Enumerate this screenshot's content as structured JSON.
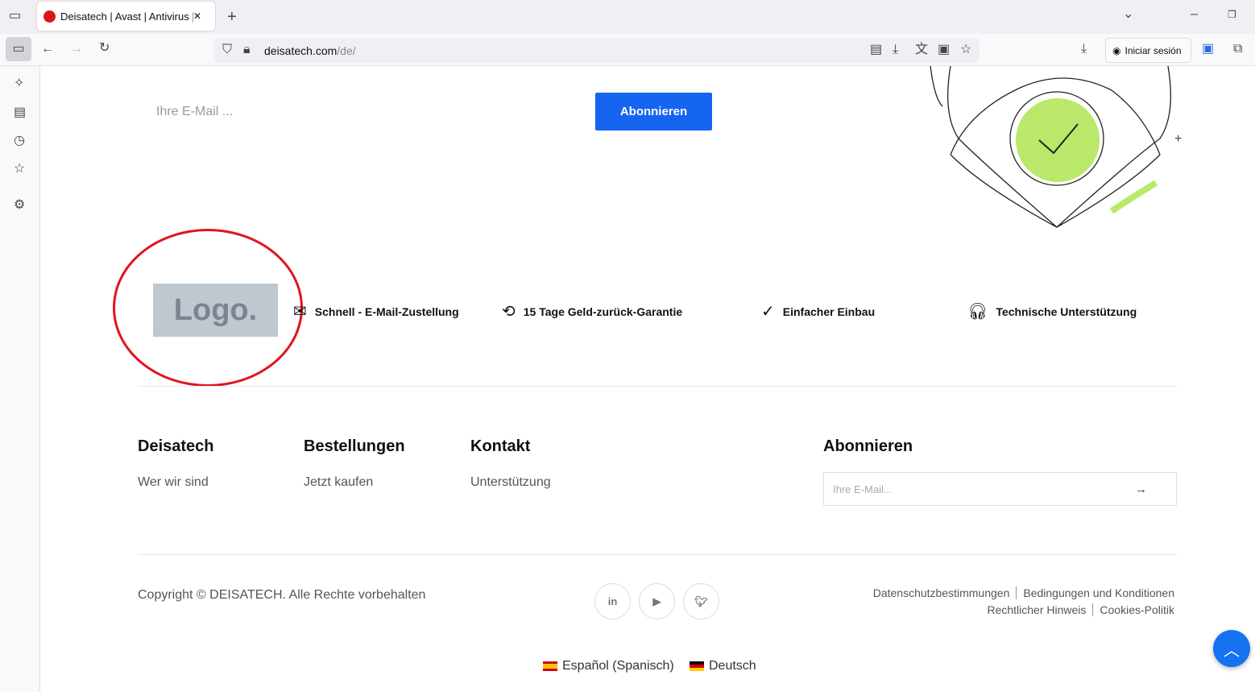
{
  "browser": {
    "tab_title": "Deisatech | Avast | Antivirus | Pr",
    "url_host": "deisatech.com",
    "url_path": "/de/",
    "signin": "Iniciar sesión",
    "new_tab": "+",
    "close": "✕"
  },
  "hero": {
    "email_placeholder": "Ihre E-Mail ...",
    "subscribe_button": "Abonnieren"
  },
  "logo_text": "Logo.",
  "features": [
    {
      "icon": "envelope-icon",
      "label": "Schnell - E-Mail-Zustellung"
    },
    {
      "icon": "money-back-icon",
      "label": "15 Tage Geld-zurück-Garantie"
    },
    {
      "icon": "badge-check-icon",
      "label": "Einfacher Einbau"
    },
    {
      "icon": "headphones-icon",
      "label": "Technische Unterstützung"
    }
  ],
  "footer": {
    "columns": [
      {
        "title": "Deisatech",
        "link": "Wer wir sind"
      },
      {
        "title": "Bestellungen",
        "link": "Jetzt kaufen"
      },
      {
        "title": "Kontakt",
        "link": "Unterstützung"
      }
    ],
    "subscribe_title": "Abonnieren",
    "email_placeholder": "Ihre E-Mail...",
    "copyright": "Copyright © DEISATECH. Alle Rechte vorbehalten",
    "legal": [
      "Datenschutzbestimmungen",
      "Bedingungen und Konditionen",
      "Rechtlicher Hinweis",
      "Cookies-Politik"
    ],
    "languages": [
      "Español (Spanisch)",
      "Deutsch"
    ]
  },
  "colors": {
    "accent": "#1565f0",
    "highlight": "#e0141e"
  }
}
